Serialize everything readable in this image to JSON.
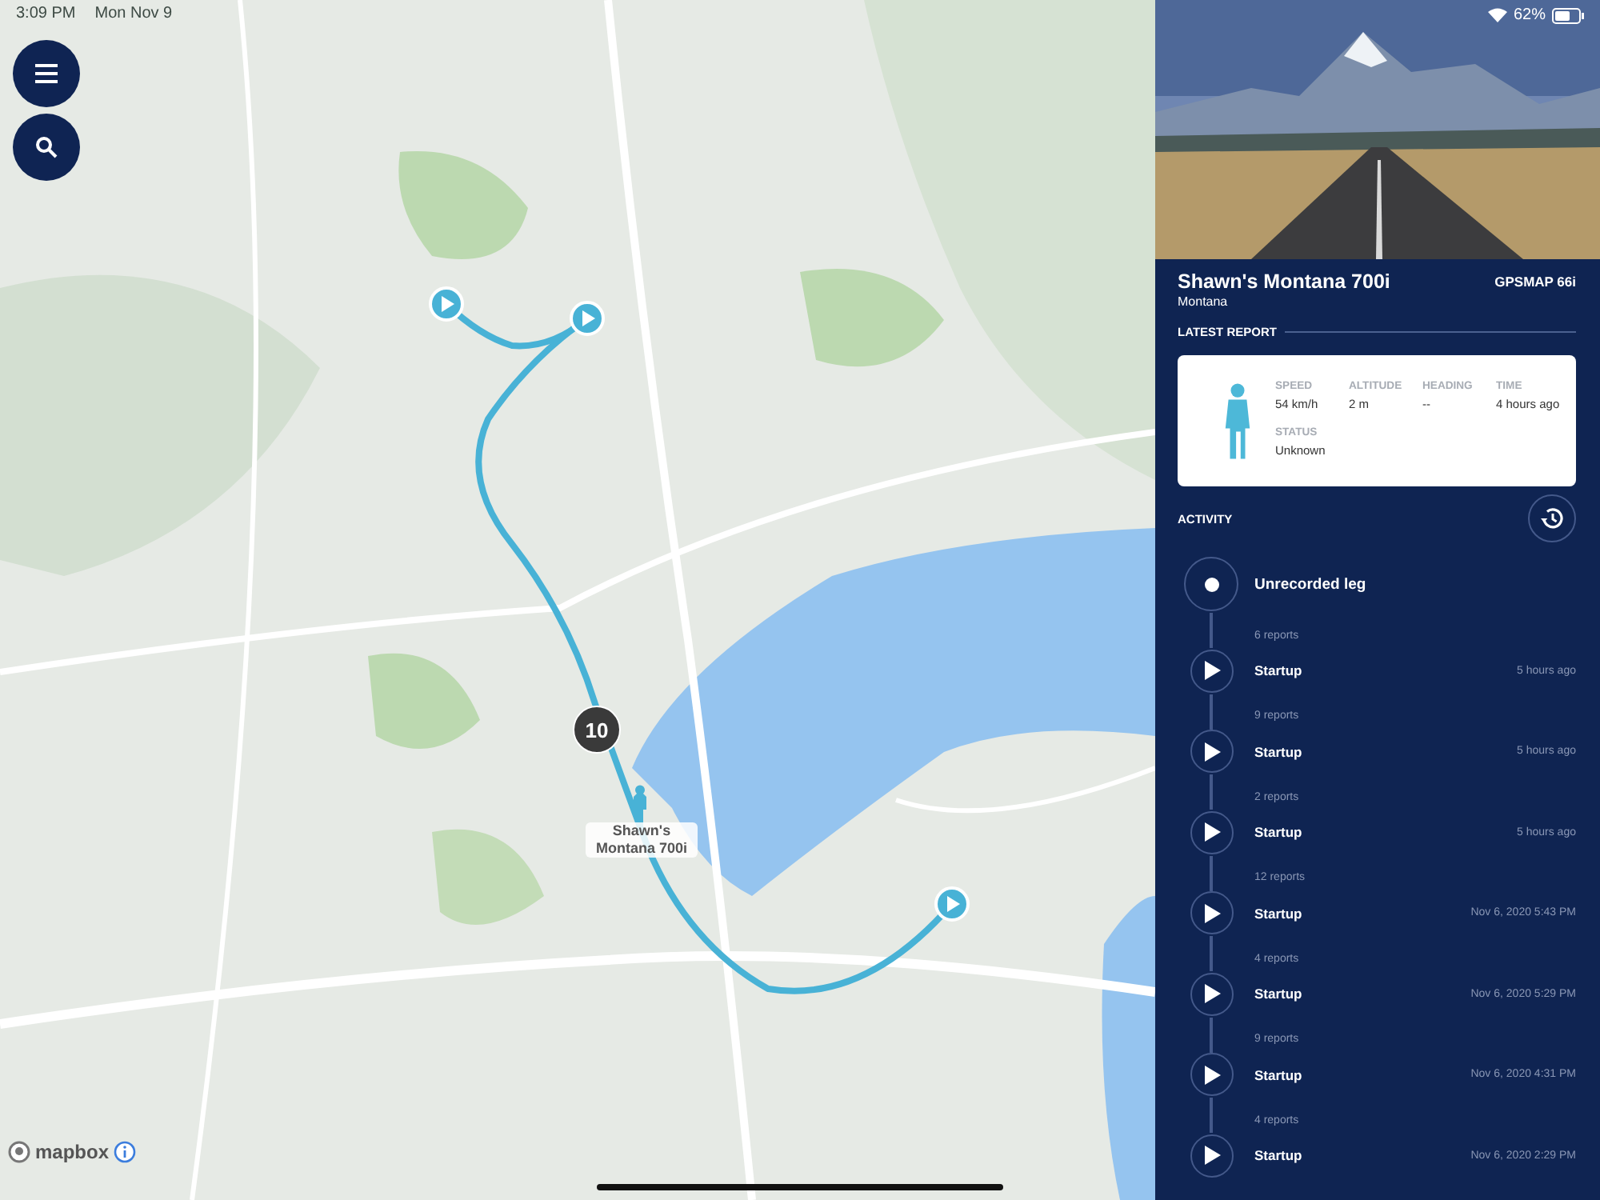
{
  "status_bar": {
    "time": "3:09 PM",
    "date": "Mon Nov 9",
    "battery": "62%"
  },
  "map": {
    "cluster": "10",
    "device_label": "Shawn's Montana 700i",
    "attribution": "mapbox"
  },
  "device": {
    "name": "Shawn's Montana 700i",
    "model_line": "Montana",
    "model": "GPSMAP 66i"
  },
  "latest_report": {
    "heading": "LATEST REPORT",
    "fields": [
      {
        "label": "SPEED",
        "value": "54 km/h"
      },
      {
        "label": "ALTITUDE",
        "value": "2 m"
      },
      {
        "label": "HEADING",
        "value": "--"
      },
      {
        "label": "TIME",
        "value": "4 hours ago"
      },
      {
        "label": "STATUS",
        "value": "Unknown"
      }
    ]
  },
  "activity": {
    "heading": "ACTIVITY",
    "current": {
      "title": "Unrecorded leg"
    },
    "entries": [
      {
        "reports": "6 reports",
        "title": "Startup",
        "time": "5 hours ago"
      },
      {
        "reports": "9 reports",
        "title": "Startup",
        "time": "5 hours ago"
      },
      {
        "reports": "2 reports",
        "title": "Startup",
        "time": "5 hours ago"
      },
      {
        "reports": "12 reports",
        "title": "Startup",
        "time": "Nov 6, 2020 5:43 PM"
      },
      {
        "reports": "4 reports",
        "title": "Startup",
        "time": "Nov 6, 2020 5:29 PM"
      },
      {
        "reports": "9 reports",
        "title": "Startup",
        "time": "Nov 6, 2020 4:31 PM"
      },
      {
        "reports": "4 reports",
        "title": "Startup",
        "time": "Nov 6, 2020 2:29 PM"
      }
    ]
  }
}
